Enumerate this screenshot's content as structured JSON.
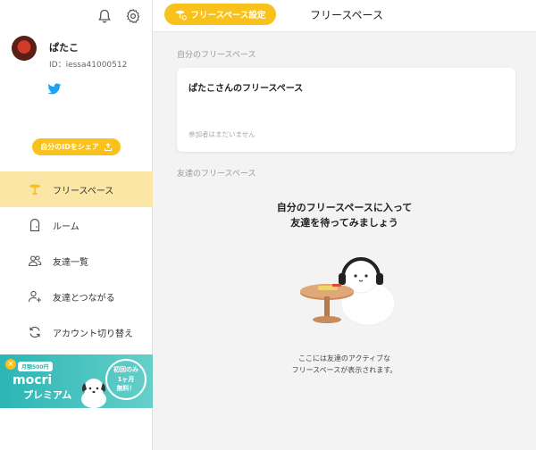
{
  "sidebar": {
    "user": {
      "name": "ぱたこ",
      "id": "ID：iessa41000512"
    },
    "share_button": "自分のIDをシェア",
    "nav": [
      {
        "label": "フリースペース",
        "icon": "table-icon",
        "active": true
      },
      {
        "label": "ルーム",
        "icon": "door-icon",
        "active": false
      },
      {
        "label": "友達一覧",
        "icon": "friends-icon",
        "active": false
      },
      {
        "label": "友達とつながる",
        "icon": "add-friend-icon",
        "active": false
      },
      {
        "label": "アカウント切り替え",
        "icon": "switch-icon",
        "active": false
      }
    ],
    "banner": {
      "close": "×",
      "price": "月額500円",
      "brand": "mocri",
      "premium": "プレミアム",
      "badge": "初回のみ\n1ヶ月\n無料！"
    }
  },
  "header": {
    "settings_button": "フリースペース設定",
    "title": "フリースペース"
  },
  "main": {
    "my_section_label": "自分のフリースペース",
    "my_card": {
      "title": "ぱたこさんのフリースペース",
      "note": "参加者はまだいません"
    },
    "friends_section_label": "友達のフリースペース",
    "empty": {
      "title_line1": "自分のフリースペースに入って",
      "title_line2": "友達を待ってみましょう",
      "desc_line1": "ここには友達のアクティブな",
      "desc_line2": "フリースペースが表示されます。"
    }
  },
  "colors": {
    "accent": "#f8c11c",
    "active_nav": "#fce6a6",
    "twitter": "#1da1f2",
    "banner": "#2bb5b5"
  }
}
